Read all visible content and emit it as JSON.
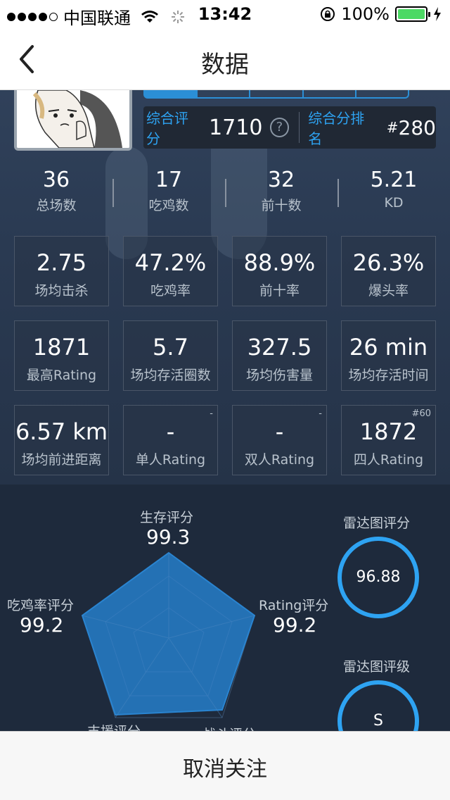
{
  "status_bar": {
    "carrier": "中国联通",
    "time": "13:42",
    "battery": "100%"
  },
  "nav": {
    "title": "数据"
  },
  "score": {
    "label": "综合评分",
    "value": "1710",
    "help": "?",
    "rank_label": "综合分排名",
    "rank_hash": "#",
    "rank_value": "280"
  },
  "summary": [
    {
      "value": "36",
      "label": "总场数"
    },
    {
      "value": "17",
      "label": "吃鸡数"
    },
    {
      "value": "32",
      "label": "前十数"
    },
    {
      "value": "5.21",
      "label": "KD"
    }
  ],
  "stats_row1": [
    {
      "value": "2.75",
      "label": "场均击杀"
    },
    {
      "value": "47.2%",
      "label": "吃鸡率"
    },
    {
      "value": "88.9%",
      "label": "前十率"
    },
    {
      "value": "26.3%",
      "label": "爆头率"
    }
  ],
  "stats_row2": [
    {
      "value": "1871",
      "label": "最高Rating"
    },
    {
      "value": "5.7",
      "label": "场均存活圈数"
    },
    {
      "value": "327.5",
      "label": "场均伤害量"
    },
    {
      "value": "26 min",
      "label": "场均存活时间"
    }
  ],
  "stats_row3": [
    {
      "value": "6.57 km",
      "label": "场均前进距离",
      "corner": ""
    },
    {
      "value": "-",
      "label": "单人Rating",
      "corner": "-"
    },
    {
      "value": "-",
      "label": "双人Rating",
      "corner": "-"
    },
    {
      "value": "1872",
      "label": "四人Rating",
      "corner": "#60"
    }
  ],
  "radar": {
    "survival_label": "生存评分",
    "survival_value": "99.3",
    "rating_label": "Rating评分",
    "rating_value": "99.2",
    "chicken_label": "吃鸡率评分",
    "chicken_value": "99.2",
    "support_label": "支援评分",
    "combat_label": "战斗评分",
    "fill_color": "#2471b4"
  },
  "side": {
    "radar_score_title": "雷达图评分",
    "radar_score_value": "96.88",
    "radar_grade_title": "雷达图评级",
    "radar_grade_value": "S"
  },
  "bottom": {
    "unfollow_label": "取消关注"
  }
}
